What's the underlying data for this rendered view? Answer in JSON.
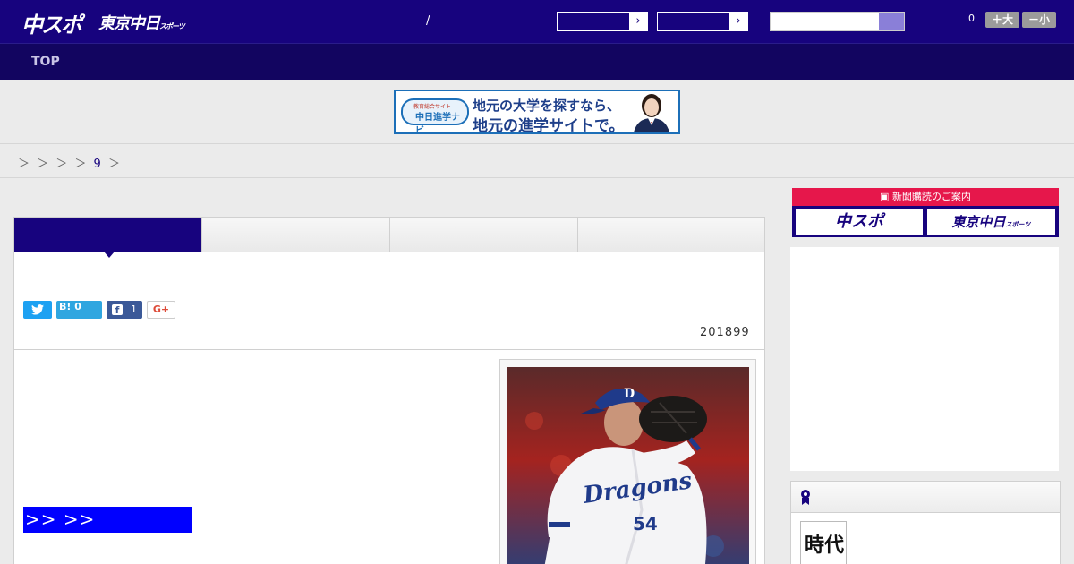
{
  "header": {
    "logo_chunichi": "中スポ",
    "logo_tokyo": "東京中日",
    "logo_tokyo_small": "スポーツ",
    "slash": "/",
    "select_arrow_1": "›",
    "select_arrow_2": "›",
    "font_count": "0",
    "font_larger": "＋大",
    "font_smaller": "－小"
  },
  "nav": {
    "top_label": "TOP"
  },
  "banner": {
    "logo_small": "教育総合サイト",
    "logo_main": "中日進学ナビ",
    "line1": "地元の大学を探すなら、",
    "line2": "地元の進学サイトで。"
  },
  "breadcrumb": {
    "sep": "＞ ＞ ＞ ＞",
    "num": "9",
    "tail": "＞"
  },
  "share": {
    "twitter_icon": "twitter-bird",
    "hatena_label": "B!",
    "hatena_count": "0",
    "facebook_letter": "f",
    "facebook_count": "1",
    "gplus_label": "G+"
  },
  "article": {
    "date": "201899",
    "more_link": ">> >>",
    "photo_jersey_text": "Dragons",
    "photo_number": "54",
    "photo_cap_letter": "D"
  },
  "sidebar": {
    "subscribe_header": "新聞購読のご案内",
    "subscribe_chunichi": "中スポ",
    "subscribe_tokyo": "東京中日",
    "subscribe_tokyo_small": "スポーツ",
    "thumb_text": "時代"
  },
  "colors": {
    "header_bg": "#17037e",
    "nav_bg": "#120560",
    "accent_red": "#e6174b",
    "link_blue": "#0000ff"
  }
}
